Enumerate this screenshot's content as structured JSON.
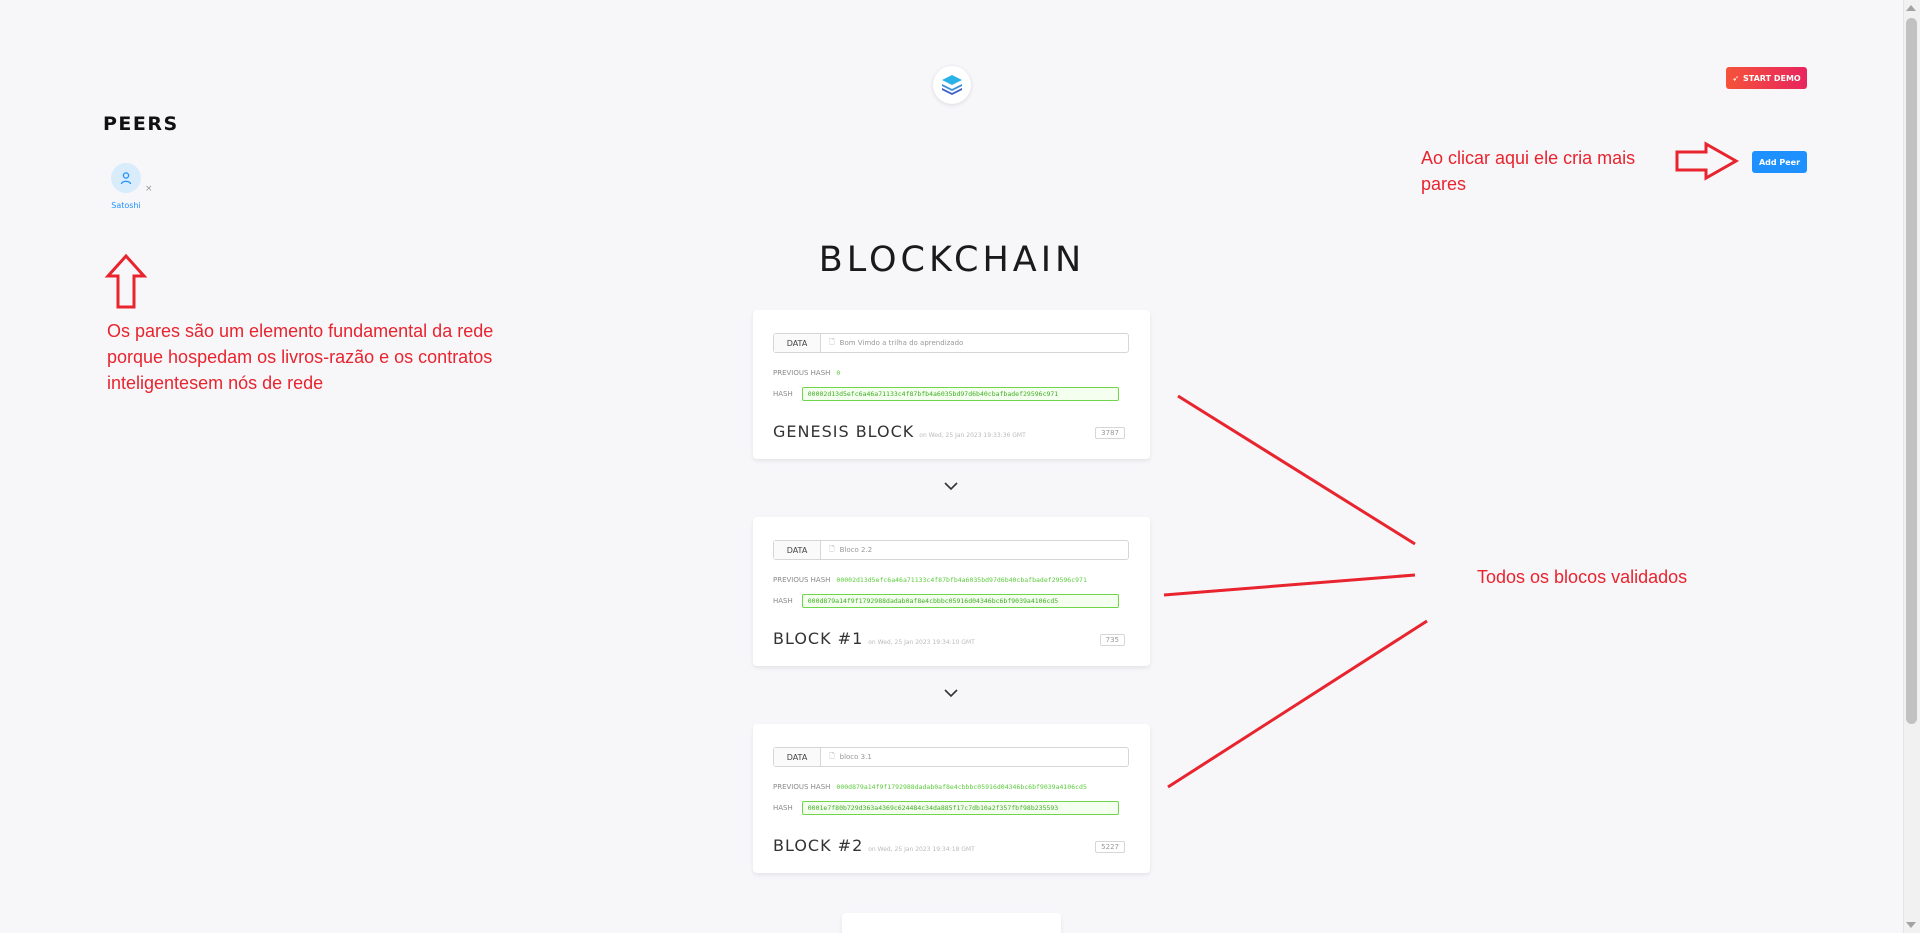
{
  "header": {
    "start_demo_label": "START DEMO",
    "add_peer_label": "Add Peer"
  },
  "peers": {
    "title": "PEERS",
    "items": [
      {
        "name": "Satoshi",
        "remove": "×"
      }
    ]
  },
  "annotations": {
    "peers_note": "Os pares são um elemento fundamental da rede porque hospedam os livros-razão e os contratos inteligentesem nós de rede",
    "add_peer_note": "Ao clicar aqui ele cria mais pares",
    "blocks_note": "Todos os blocos validados"
  },
  "blockchain": {
    "title": "BLOCKCHAIN",
    "data_label": "DATA",
    "prev_hash_label": "PREVIOUS HASH",
    "hash_label": "HASH",
    "blocks": [
      {
        "data": "Bom Vimdo a trilha do aprendizado",
        "previous_hash": "0",
        "hash": "00002d13d5efc6a46a71133c4f87bfb4a6035bd97d6b40cbafbadef29596c971",
        "name": "GENESIS BLOCK",
        "date": "on Wed, 25 Jan 2023 19:33:36 GMT",
        "nonce": "3787"
      },
      {
        "data": "Bloco 2.2",
        "previous_hash": "00002d13d5efc6a46a71133c4f87bfb4a6035bd97d6b40cbafbadef29596c971",
        "hash": "000d879a14f9f1792988dadab0af8e4cbbbc05916d04346bc6bf9039a4106cd5",
        "name": "BLOCK #1",
        "date": "on Wed, 25 Jan 2023 19:34:10 GMT",
        "nonce": "735"
      },
      {
        "data": "bloco 3.1",
        "previous_hash": "000d879a14f9f1792988dadab0af8e4cbbbc05916d04346bc6bf9039a4106cd5",
        "hash": "0001e7f80b729d363a4369c624484c34da885f17c7db10a2f357fbf98b235593",
        "name": "BLOCK #2",
        "date": "on Wed, 25 Jan 2023 19:34:18 GMT",
        "nonce": "5227"
      }
    ]
  },
  "colors": {
    "accent": "#1e90ff",
    "hash_green": "#5ccc3d",
    "annotation_red": "#e8242e"
  }
}
